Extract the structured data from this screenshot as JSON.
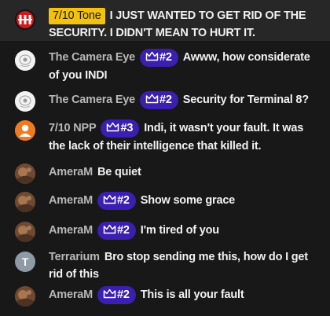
{
  "messages": [
    {
      "author": "7/10 Tone",
      "author_style": "highlight",
      "badge": "",
      "avatar": "logo-avatar",
      "text": "I JUST WANTED TO GET RID OF THE SECURITY. I DIDN'T MEAN TO HURT IT."
    },
    {
      "author": "The Camera Eye",
      "badge": "#2",
      "avatar": "eye-avatar",
      "text": "Awww, how considerate of you INDI"
    },
    {
      "author": "The Camera Eye",
      "badge": "#2",
      "avatar": "eye-avatar",
      "text": "Security for Terminal 8?"
    },
    {
      "author": "7/10 NPP",
      "badge": "#3",
      "avatar": "default-user-avatar",
      "text": "Indi, it wasn't your fault. It was the lack of their intelligence that killed it."
    },
    {
      "author": "AmeraM",
      "badge": "",
      "avatar": "photo-avatar",
      "text": "Be quiet"
    },
    {
      "author": "AmeraM",
      "badge": "#2",
      "avatar": "photo-avatar",
      "text": "Show some grace"
    },
    {
      "author": "AmeraM",
      "badge": "#2",
      "avatar": "photo-avatar",
      "text": "I'm tired of you"
    },
    {
      "author": "Terrarium",
      "badge": "",
      "avatar": "letter-avatar",
      "avatar_letter": "T",
      "text": "Bro stop sending me this, how do I get rid of this"
    },
    {
      "author": "AmeraM",
      "badge": "#2",
      "avatar": "photo-avatar",
      "text": "This is all your fault"
    }
  ],
  "colors": {
    "background": "#181818",
    "highlight_row": "#272727",
    "tone_badge": "#f2c20d",
    "rank_badge": "#3a1fb0",
    "author_text": "#b8b8b8",
    "message_text": "#f1f1f1"
  },
  "icons": {
    "rank_badge": "crown-icon"
  }
}
